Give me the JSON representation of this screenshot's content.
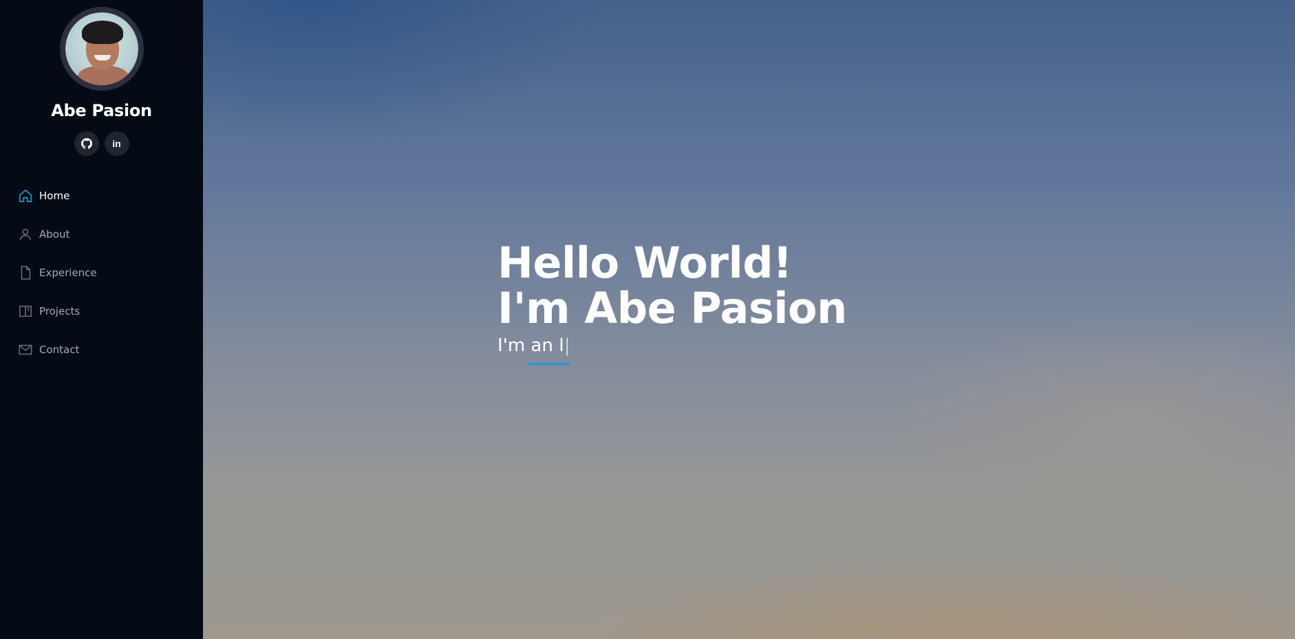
{
  "profile": {
    "name": "Abe Pasion",
    "socials": [
      {
        "icon": "github-icon"
      },
      {
        "icon": "linkedin-icon",
        "label": "in"
      }
    ]
  },
  "nav": {
    "items": [
      {
        "label": "Home",
        "icon": "home-icon",
        "active": true
      },
      {
        "label": "About",
        "icon": "person-icon"
      },
      {
        "label": "Experience",
        "icon": "file-icon"
      },
      {
        "label": "Projects",
        "icon": "book-icon"
      },
      {
        "label": "Contact",
        "icon": "envelope-icon"
      }
    ]
  },
  "hero": {
    "line1": "Hello World!",
    "line2": "I'm Abe Pasion",
    "typed_text": "I'm an I",
    "typed_cursor": "|"
  },
  "colors": {
    "accent": "#149ddd",
    "sidebar_bg": "#040b14"
  }
}
